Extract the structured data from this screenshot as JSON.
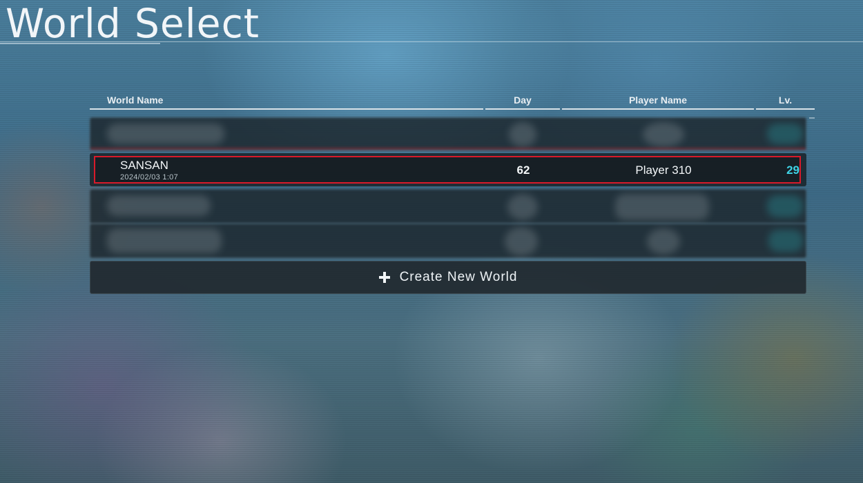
{
  "page": {
    "title": "World Select"
  },
  "table": {
    "columns": {
      "world_name": "World Name",
      "day": "Day",
      "player_name": "Player Name",
      "level": "Lv."
    },
    "selected_row": {
      "world_name": "SANSAN",
      "last_played": "2024/02/03 1:07",
      "day": "62",
      "player_name": "Player 310",
      "level": "29"
    }
  },
  "actions": {
    "create_world_label": "Create New World",
    "create_world_icon": "plus-icon"
  },
  "colors": {
    "selection_border": "#d91a2a",
    "level_text": "#3fd3e6"
  }
}
